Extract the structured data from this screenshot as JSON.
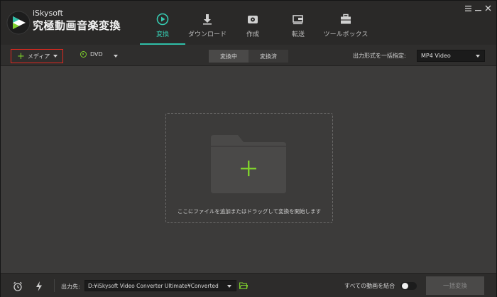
{
  "app": {
    "brand_small": "iSkysoft",
    "brand_large": "究極動画音楽変換"
  },
  "nav": [
    {
      "label": "変換",
      "icon": "convert-icon",
      "active": true
    },
    {
      "label": "ダウンロード",
      "icon": "download-icon",
      "active": false
    },
    {
      "label": "作成",
      "icon": "create-disc-icon",
      "active": false
    },
    {
      "label": "転送",
      "icon": "transfer-icon",
      "active": false
    },
    {
      "label": "ツールボックス",
      "icon": "toolbox-icon",
      "active": false
    }
  ],
  "window_controls": [
    "menu-icon",
    "minimize-icon",
    "close-icon"
  ],
  "toolbar": {
    "media_label": "メディア",
    "dvd_label": "DVD",
    "tab_converting": "変換中",
    "tab_converted": "変換済",
    "format_label": "出力形式を一括指定:",
    "format_value": "MP4 Video"
  },
  "dropzone": {
    "hint": "ここにファイルを追加またはドラッグして変換を開始します"
  },
  "bottom": {
    "output_label": "出力先:",
    "output_path": "D:¥iSkysoft Video Converter Ultimate¥Converted",
    "merge_label": "すべての動画を結合",
    "merge_on": false,
    "convert_all_label": "一括変換"
  },
  "colors": {
    "accent_teal": "#2fbfa8",
    "accent_green": "#7fd12c",
    "highlight_red": "#e0281f"
  }
}
